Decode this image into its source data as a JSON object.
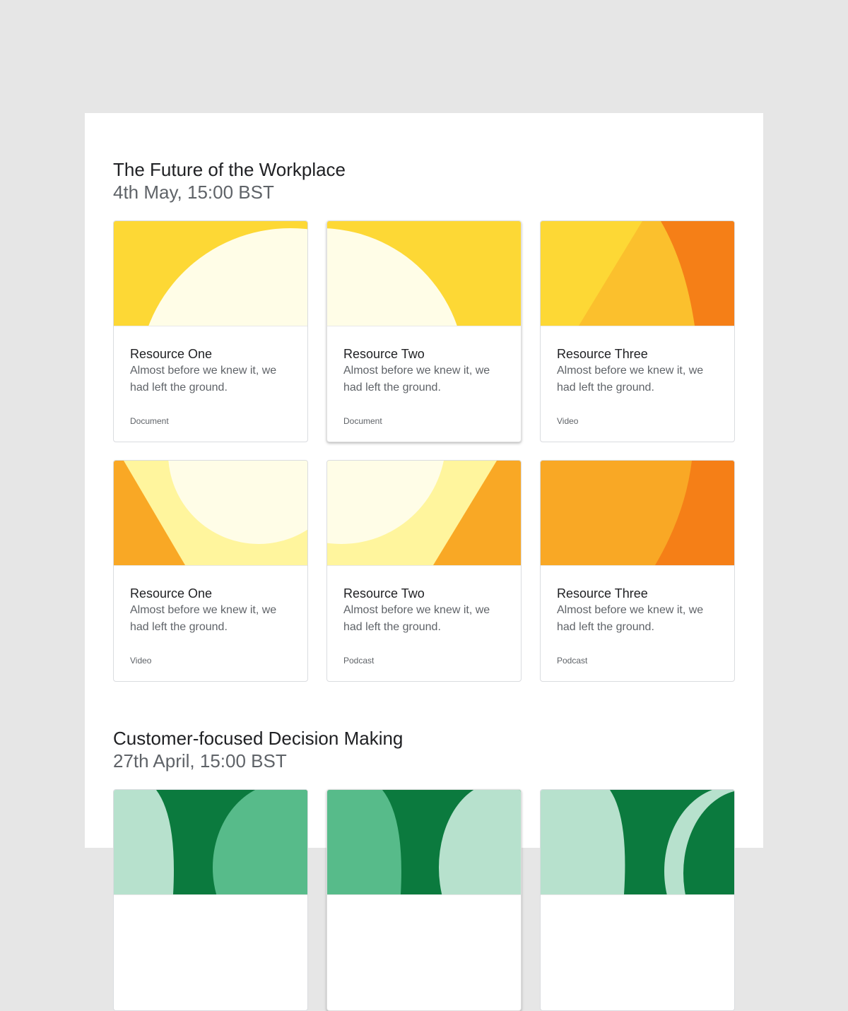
{
  "sections": [
    {
      "title": "The Future of the Workplace",
      "date": "4th May, 15:00 BST",
      "cards": [
        {
          "title": "Resource One",
          "description": "Almost before we knew it, we had left the ground.",
          "type": "Document"
        },
        {
          "title": "Resource Two",
          "description": "Almost before we knew it, we had left the ground.",
          "type": "Document"
        },
        {
          "title": "Resource Three",
          "description": "Almost before we knew it, we had left the ground.",
          "type": "Video"
        },
        {
          "title": "Resource One",
          "description": "Almost before we knew it, we had left the ground.",
          "type": "Video"
        },
        {
          "title": "Resource Two",
          "description": "Almost before we knew it, we had left the ground.",
          "type": "Podcast"
        },
        {
          "title": "Resource Three",
          "description": "Almost before we knew it, we had left the ground.",
          "type": "Podcast"
        }
      ]
    },
    {
      "title": "Customer-focused Decision Making",
      "date": "27th April, 15:00 BST"
    }
  ],
  "colors": {
    "page_bg": "#e6e6e6",
    "yellow": "#fdd835",
    "cream": "#fffde7",
    "light_yellow": "#fff59d",
    "amber": "#fbc02d",
    "orange": "#f9a825",
    "deep_orange": "#f57f17",
    "mint": "#b7e1cd",
    "green": "#57bb8a",
    "dark_green": "#0b7a3e"
  }
}
